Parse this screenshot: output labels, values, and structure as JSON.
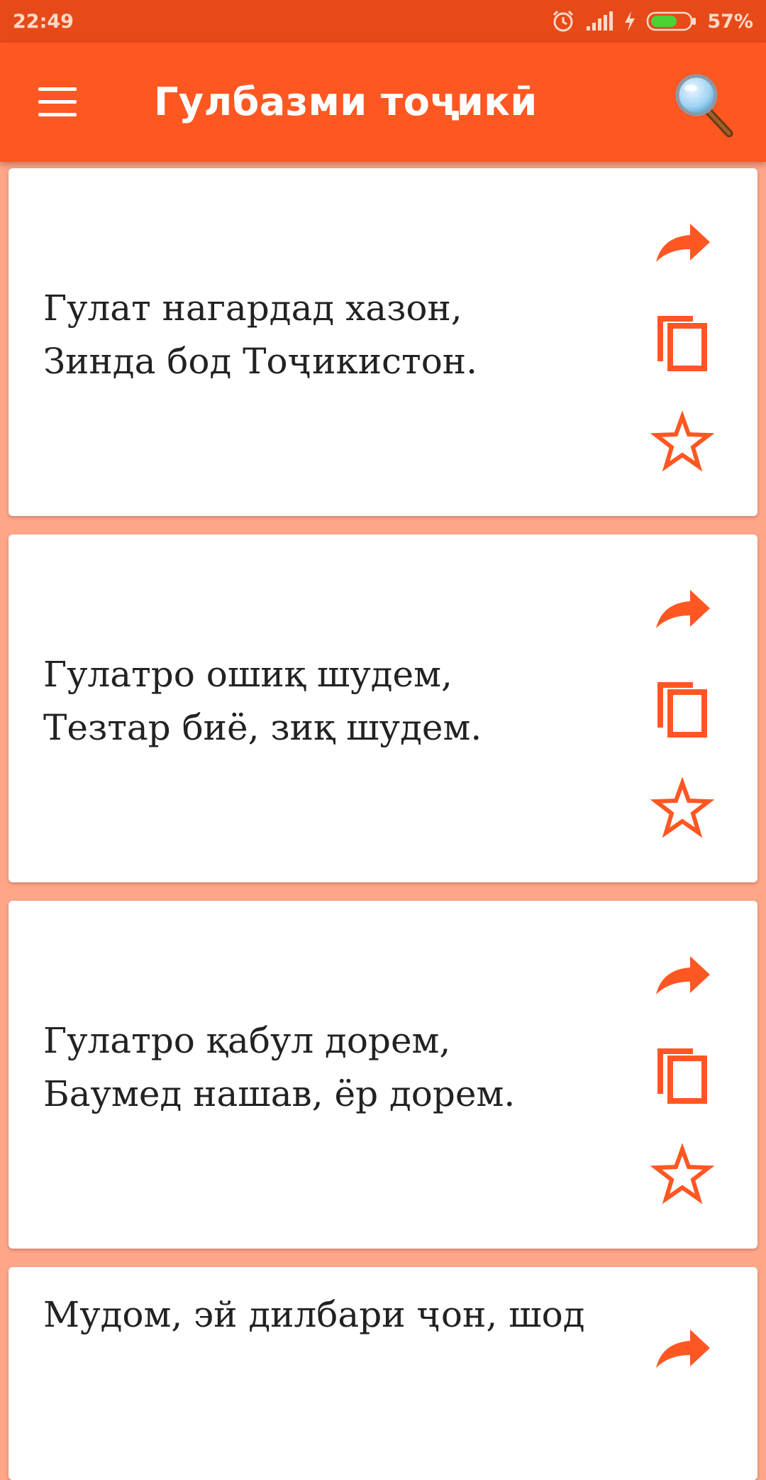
{
  "status_bar": {
    "time": "22:49",
    "battery": "57%"
  },
  "app_bar": {
    "title": "Гулбазми тоҷикӣ",
    "menu_icon": "hamburger-menu-icon",
    "search_icon": "search-magnifier-icon"
  },
  "theme": {
    "primary": "#FF5722",
    "primary_dark": "#E64A19",
    "background": "#FFA588"
  },
  "cards": [
    {
      "text": "Гулат нагардад хазон,\nЗинда бод Тоҷикистон."
    },
    {
      "text": "Гулатро ошиқ шудем,\nТезтар биё, зиқ шудем."
    },
    {
      "text": "Гулатро қабул дорем,\nБаумед нашав, ёр дорем."
    },
    {
      "text": "Мудом, эй дилбари ҷон, шод"
    }
  ]
}
